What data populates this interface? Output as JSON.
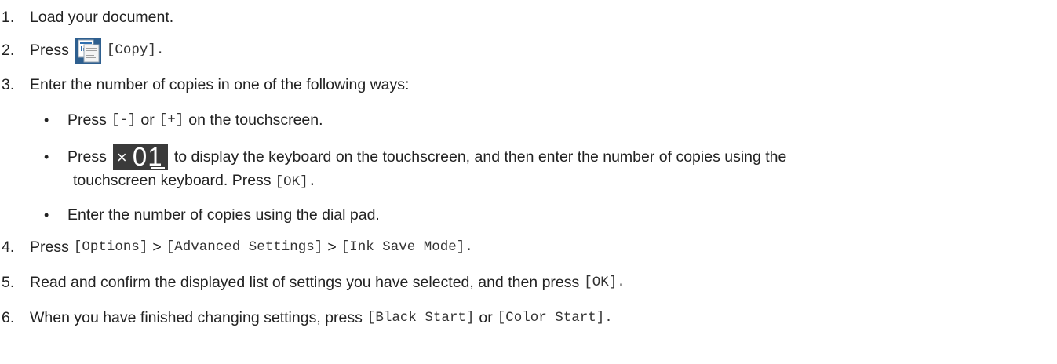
{
  "steps": [
    {
      "num": "1.",
      "text": "Load your document."
    },
    {
      "num": "2.",
      "pre": "Press",
      "icon": "copy-icon",
      "code": "[Copy]."
    },
    {
      "num": "3.",
      "text": "Enter the number of copies in one of the following ways:"
    },
    {
      "num": "4.",
      "pre": "Press",
      "c1": "[Options]",
      "sep1": ">",
      "c2": "[Advanced Settings]",
      "sep2": ">",
      "c3": "[Ink Save Mode]."
    },
    {
      "num": "5.",
      "text": "Read and confirm the displayed list of settings you have selected, and then press",
      "code": "[OK]."
    },
    {
      "num": "6.",
      "text": "When you have finished changing settings, press",
      "c1": "[Black Start]",
      "or": "or",
      "c2": "[Color Start]."
    }
  ],
  "substeps": [
    {
      "bullet": "•",
      "pre": "Press",
      "c1": "[-]",
      "or": "or",
      "c2": "[+]",
      "post": "on the touchscreen."
    },
    {
      "bullet": "•",
      "pre": "Press",
      "icon_x": "×",
      "icon_num": "01",
      "post": "to display the keyboard on the touchscreen, and then enter the number of copies using the",
      "cont": "touchscreen keyboard. Press",
      "code": "[OK]."
    },
    {
      "bullet": "•",
      "text": "Enter the number of copies using the dial pad."
    }
  ]
}
